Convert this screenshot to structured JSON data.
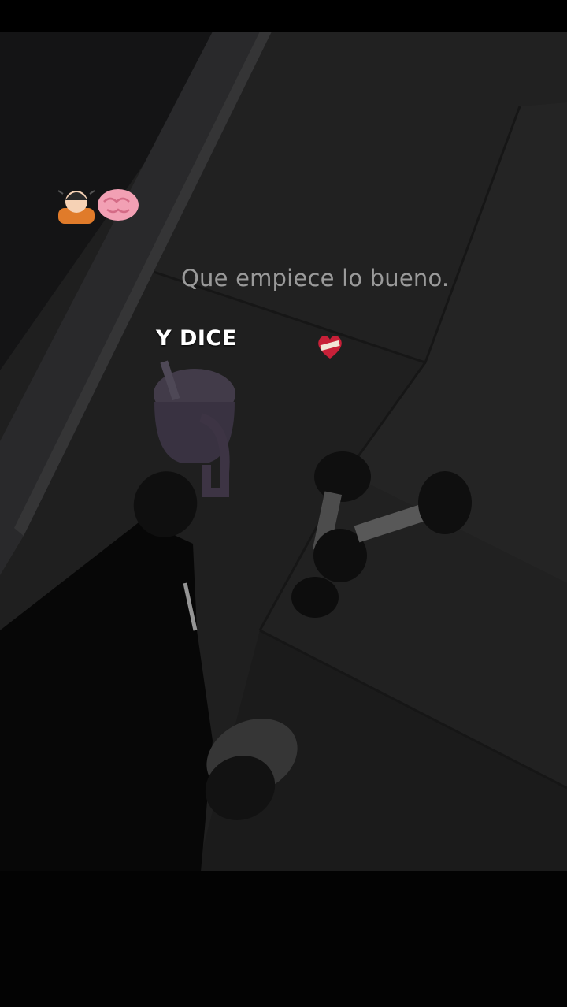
{
  "caption": "Que empiece lo bueno.",
  "overlay_text": "Y DICE",
  "stickers": {
    "left": "person-bowing-brain-emoji",
    "right": "mending-heart-emoji"
  },
  "colors": {
    "caption": "#9a9a9a",
    "overlay_text": "#ffffff",
    "floor": "#2e2e2e",
    "background": "#050505"
  }
}
